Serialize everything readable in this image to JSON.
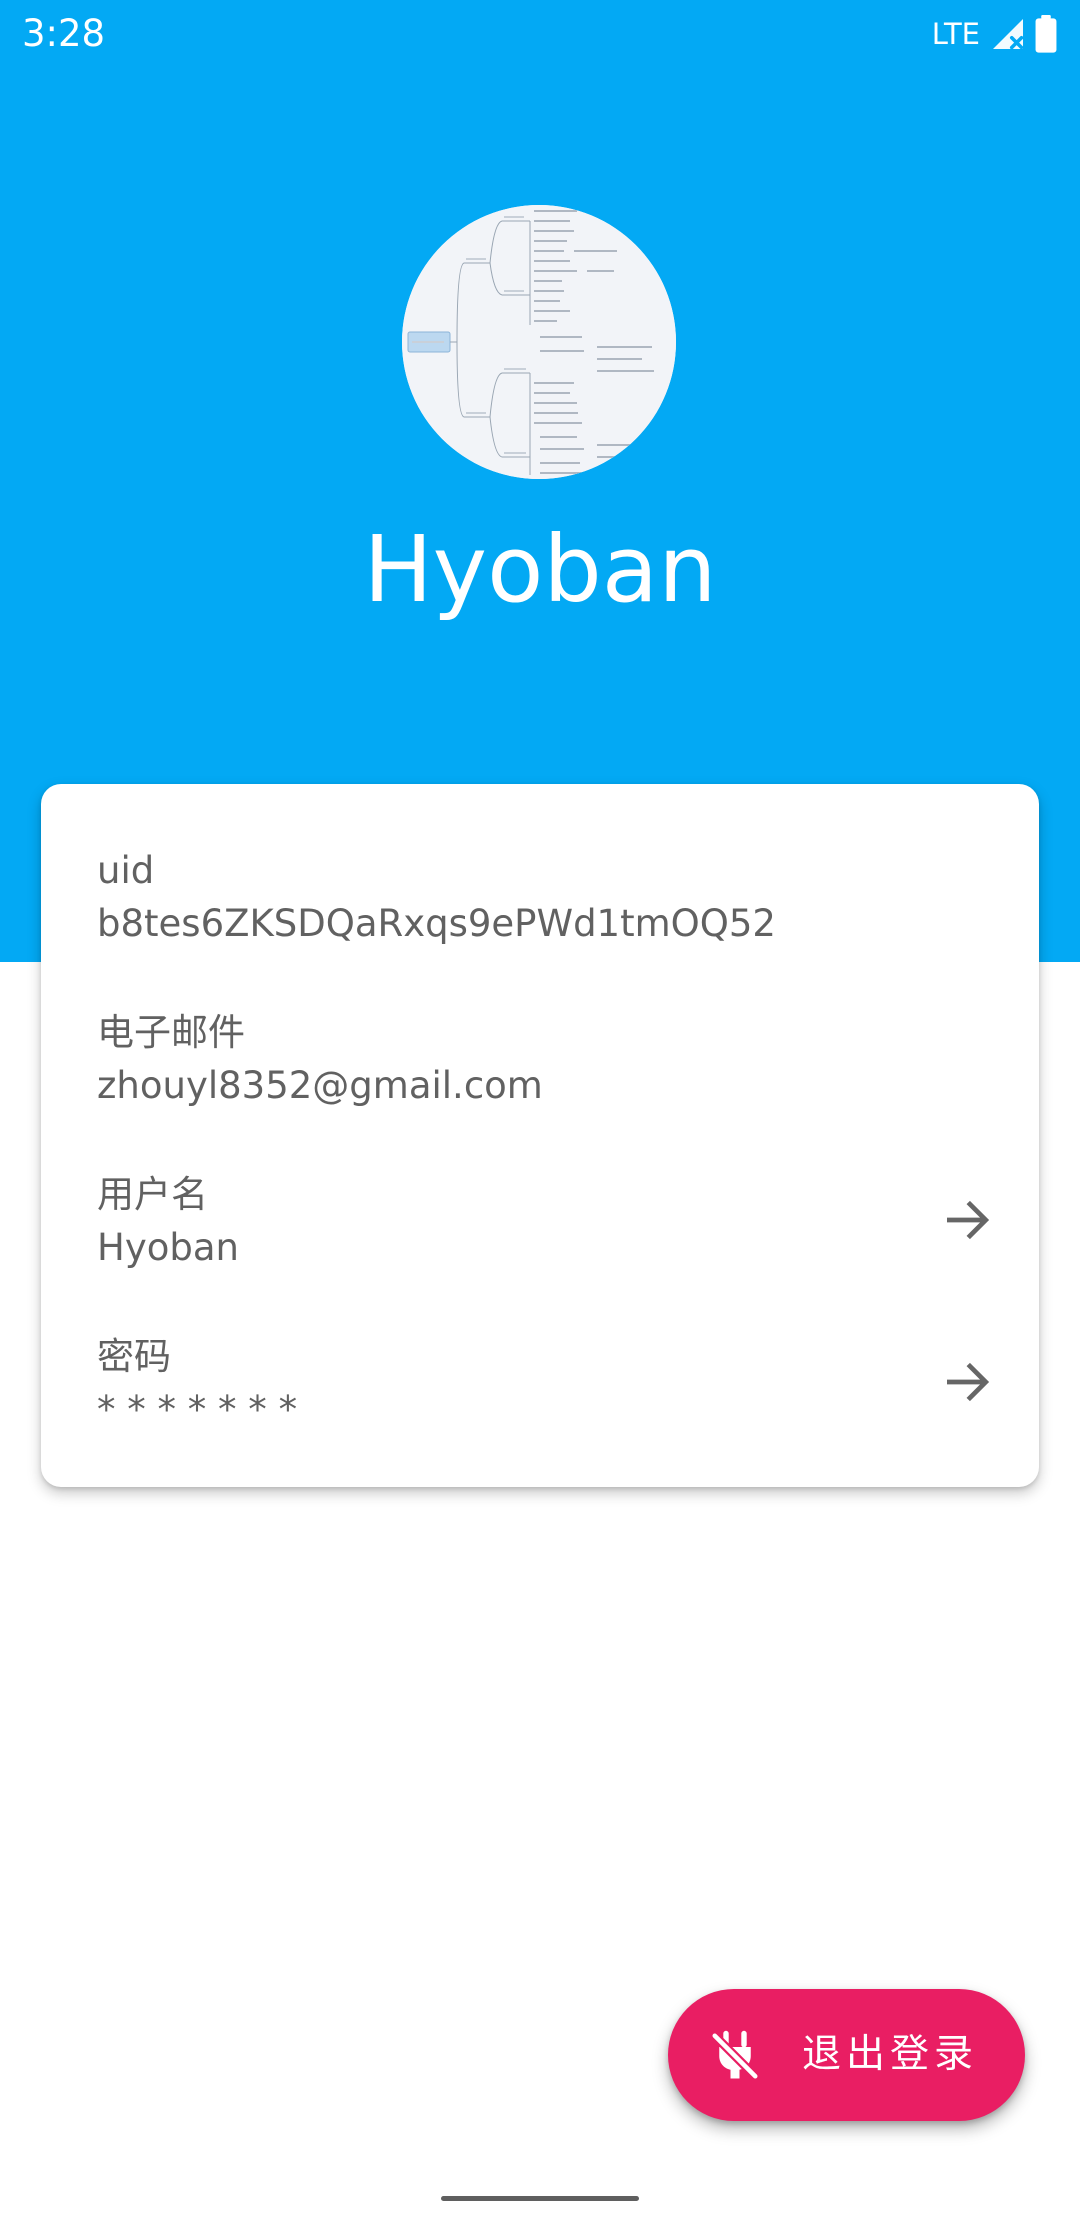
{
  "status_bar": {
    "time": "3:28",
    "network": "LTE",
    "icons": [
      "signal-no-data-icon",
      "battery-full-icon"
    ]
  },
  "profile": {
    "avatar_icon": "mind-map-thumbnail",
    "display_name": "Hyoban"
  },
  "info": {
    "uid_label": "uid",
    "uid_value": "b8tes6ZKSDQaRxqs9ePWd1tmOQ52",
    "email_label": "电子邮件",
    "email_value": "zhouyl8352@gmail.com",
    "username_label": "用户名",
    "username_value": "Hyoban",
    "password_label": "密码",
    "password_value": "* * * * * * *",
    "arrow_icon": "arrow-forward-icon"
  },
  "fab": {
    "label": "退出登录",
    "icon": "power-off-plug-icon"
  },
  "colors": {
    "header": "#03A9F4",
    "accent": "#E91E63",
    "text": "#616161"
  }
}
